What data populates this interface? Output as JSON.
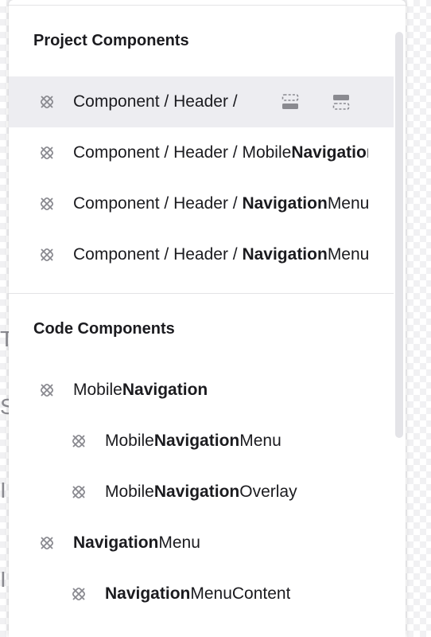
{
  "panel": {
    "project_section": {
      "title": "Project Components",
      "items": [
        {
          "parts": [
            {
              "t": "Component / Header / ",
              "b": false
            }
          ],
          "hovered": true
        },
        {
          "parts": [
            {
              "t": "Component / Header / Mobile",
              "b": false
            },
            {
              "t": "Navigation",
              "b": true
            }
          ],
          "hovered": false
        },
        {
          "parts": [
            {
              "t": "Component / Header / ",
              "b": false
            },
            {
              "t": "Navigation",
              "b": true
            },
            {
              "t": "Menu",
              "b": false
            }
          ],
          "hovered": false
        },
        {
          "parts": [
            {
              "t": "Component / Header / ",
              "b": false
            },
            {
              "t": "Navigation",
              "b": true
            },
            {
              "t": "Menu",
              "b": false
            }
          ],
          "hovered": false
        }
      ]
    },
    "code_section": {
      "title": "Code Components",
      "items": [
        {
          "level": 0,
          "parts": [
            {
              "t": "Mobile",
              "b": false
            },
            {
              "t": "Navigation",
              "b": true
            }
          ]
        },
        {
          "level": 1,
          "parts": [
            {
              "t": "Mobile",
              "b": false
            },
            {
              "t": "Navigation",
              "b": true
            },
            {
              "t": "Menu",
              "b": false
            }
          ]
        },
        {
          "level": 1,
          "parts": [
            {
              "t": "Mobile",
              "b": false
            },
            {
              "t": "Navigation",
              "b": true
            },
            {
              "t": "Overlay",
              "b": false
            }
          ]
        },
        {
          "level": 0,
          "parts": [
            {
              "t": "Navigation",
              "b": true
            },
            {
              "t": "Menu",
              "b": false
            }
          ]
        },
        {
          "level": 1,
          "parts": [
            {
              "t": "Navigation",
              "b": true
            },
            {
              "t": "MenuContent",
              "b": false
            }
          ]
        }
      ]
    },
    "hover_actions": [
      "insert-above-icon",
      "insert-below-icon"
    ],
    "component_icon": "component-icon"
  },
  "colors": {
    "hover_bg": "#ededf1",
    "icon": "#8a8a90",
    "divider": "#e3e3e6"
  }
}
